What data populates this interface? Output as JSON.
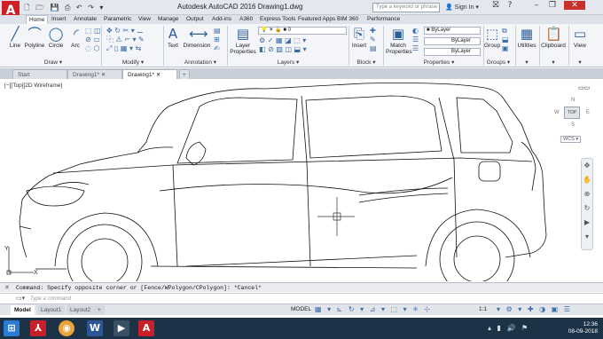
{
  "app": {
    "logo_letter": "A",
    "title": "Autodesk AutoCAD 2016    Drawing1.dwg",
    "search_placeholder": "Type a keyword or phrase",
    "signin": "Sign In",
    "qat_icons": "🗋 🗁 💾 ⎙ ↶ ↷ ▾"
  },
  "ribbon_tabs": [
    "Home",
    "Insert",
    "Annotate",
    "Parametric",
    "View",
    "Manage",
    "Output",
    "Add-ins",
    "A360",
    "Express Tools",
    "Featured Apps",
    "BIM 360",
    "Performance"
  ],
  "ribbon": {
    "draw": {
      "line": "Line",
      "polyline": "Polyline",
      "circle": "Circle",
      "arc": "Arc",
      "panel": "Draw ▾"
    },
    "modify": {
      "panel": "Modify ▾"
    },
    "annotation": {
      "text": "Text",
      "dimension": "Dimension",
      "panel": "Annotation ▾"
    },
    "layers": {
      "layer_properties": "Layer Properties",
      "current_layer": "0",
      "panel": "Layers ▾"
    },
    "block": {
      "insert": "Insert",
      "panel": "Block ▾"
    },
    "properties": {
      "match": "Match Properties",
      "color": "ByLayer",
      "linetype": "ByLayer",
      "lineweight": "ByLayer",
      "panel": "Properties ▾"
    },
    "groups": {
      "group": "Group",
      "panel": "Groups ▾"
    },
    "utilities": "Utilities",
    "clipboard": "Clipboard",
    "view": "View"
  },
  "doc_tabs": [
    "Start",
    "Drawing1*",
    "Drawing1*"
  ],
  "viewport_label": "[−][Top][2D Wireframe]",
  "viewcube": {
    "top": "TOP",
    "n": "N",
    "s": "S",
    "w": "W",
    "e": "E",
    "wcs": "WCS ▾"
  },
  "command": {
    "history": "Command: Specify opposite corner or [Fence/WPolygon/CPolygon]: *Cancel*",
    "placeholder": "Type a command"
  },
  "layout_tabs": [
    "Model",
    "Layout1",
    "Layout2"
  ],
  "status": {
    "model": "MODEL",
    "scale": "1:1"
  },
  "taskbar": {
    "time": "12:36",
    "date": "08-09-2018"
  },
  "colors": {
    "accent": "#d11f26",
    "taskbar": "#1c3246",
    "ribbon": "#f3f5f8"
  }
}
